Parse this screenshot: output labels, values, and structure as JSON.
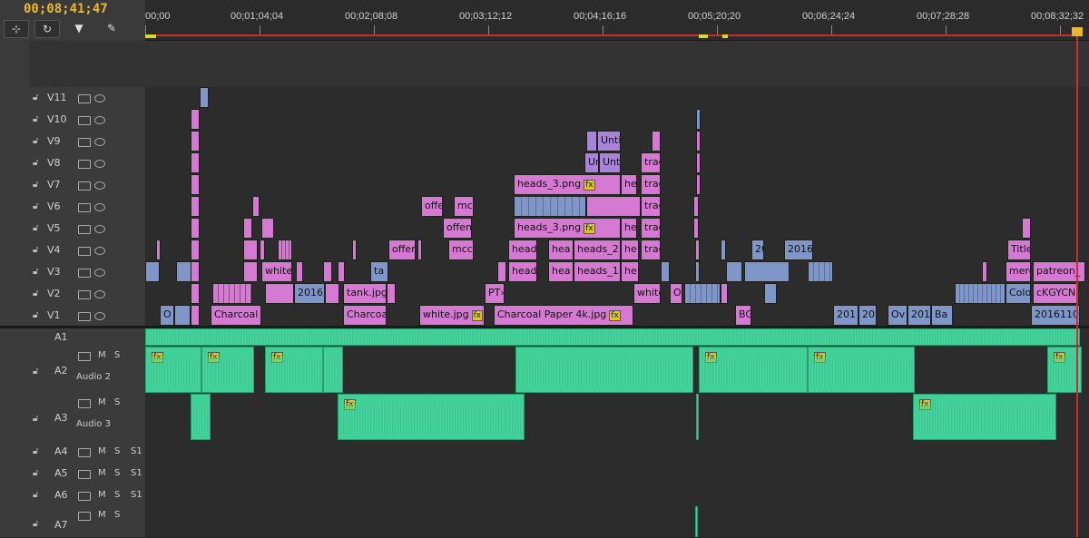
{
  "timecode": "00;08;41;47",
  "toolbar": {
    "snap_icon": "snap-icon",
    "link_icon": "linked-selection-icon",
    "marker_icon": "marker-icon",
    "settings_icon": "wrench-icon"
  },
  "ruler": {
    "labels": [
      "00;00",
      "00;01;04;04",
      "00;02;08;08",
      "00;03;12;12",
      "00;04;16;16",
      "00;05;20;20",
      "00;06;24;24",
      "00;07;28;28",
      "00;08;32;32"
    ]
  },
  "video_tracks": [
    "V11",
    "V10",
    "V9",
    "V8",
    "V7",
    "V6",
    "V5",
    "V4",
    "V3",
    "V2",
    "V1"
  ],
  "audio_tracks": [
    {
      "name": "A1",
      "label": ""
    },
    {
      "name": "A2",
      "label": "Audio 2"
    },
    {
      "name": "A3",
      "label": "Audio 3"
    },
    {
      "name": "A4",
      "label": ""
    },
    {
      "name": "A5",
      "label": ""
    },
    {
      "name": "A6",
      "label": ""
    },
    {
      "name": "A7",
      "label": ""
    }
  ],
  "audio_buttons": {
    "mute": "M",
    "solo": "S",
    "submix": "S1"
  },
  "clip_labels": {
    "v9_unti": "Unti",
    "v8_un": "Un",
    "v8_unti": "Unti",
    "v8_trac": "trac",
    "v7_heads3": "heads_3.png",
    "v7_he": "he",
    "v7_trac": "trac",
    "v6_offe": "offe",
    "v6_mc": "mc",
    "v6_trac": "trac",
    "v5_offen": "offen",
    "v5_heads3": "heads_3.png",
    "v5_he": "he",
    "v5_trac": "trac",
    "v4_offer": "offer",
    "v4_mcc": "mcc",
    "v4_head": "head",
    "v4_hea": "hea",
    "v4_heads2": "heads_2.",
    "v4_he": "he",
    "v4_trac": "trac",
    "v4_20": "20",
    "v4_2016": "2016",
    "v4_title": "Title",
    "v3_white": "white",
    "v3_ta": "ta",
    "v3_head": "head",
    "v3_hea": "hea",
    "v3_heads1": "heads_1.",
    "v3_he": "he",
    "v3_merc": "merc",
    "v3_patreon": "patreon_",
    "v2_2016": "2016",
    "v2_tank": "tank.jpg",
    "v2_pt": "PT›",
    "v2_white": "white",
    "v2_o": "O",
    "v2_colo": "Colo",
    "v2_ckg": "cKGYCN",
    "v1_o": "O",
    "v1_charcoal1": "Charcoal",
    "v1_charcoal2": "Charcoa",
    "v1_white": "white.jpg",
    "v1_charcoal_paper": "Charcoal Paper 4k.jpg",
    "v1_bg": "BG",
    "v1_201": "201",
    "v1_20": "20",
    "v1_ov": "Ov",
    "v1_2016": "2016",
    "v1_ba": "Ba",
    "v1_2016110": "2016110"
  },
  "fx_badge": "fx",
  "colors": {
    "timecode": "#e8b830",
    "clip_pink": "#d679d3",
    "clip_blue": "#7f96c8",
    "clip_purple": "#a983d8",
    "audio_green": "#3fd198",
    "playhead": "#c83030"
  }
}
